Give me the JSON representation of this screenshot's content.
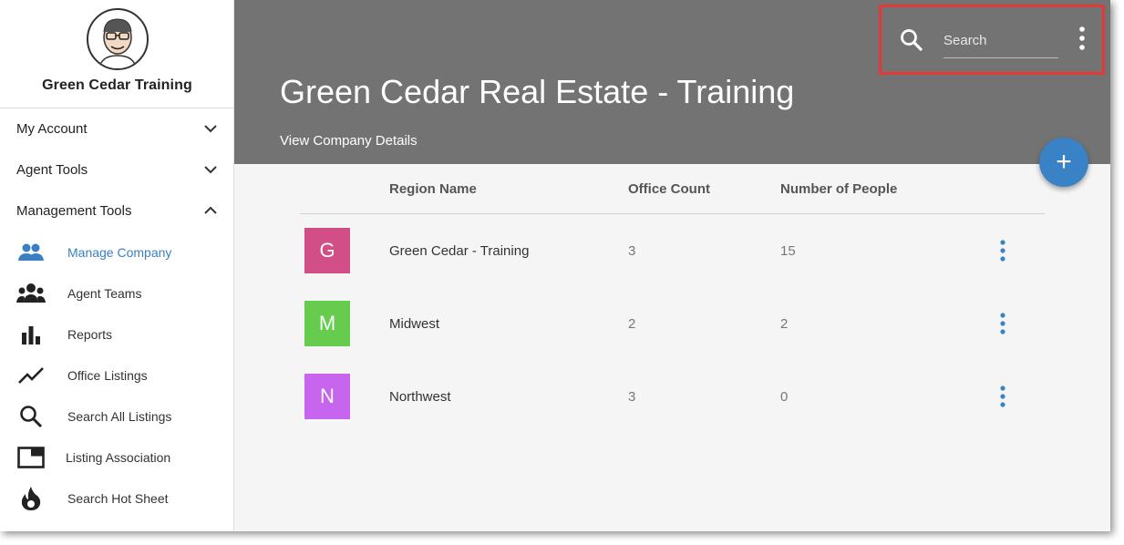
{
  "sidebar": {
    "profile_name": "Green Cedar Training",
    "sections": [
      {
        "label": "My Account",
        "expanded": false
      },
      {
        "label": "Agent Tools",
        "expanded": false
      },
      {
        "label": "Management Tools",
        "expanded": true
      }
    ],
    "items": [
      {
        "label": "Manage Company",
        "icon": "people-icon",
        "active": true
      },
      {
        "label": "Agent Teams",
        "icon": "team-icon",
        "active": false
      },
      {
        "label": "Reports",
        "icon": "bar-chart-icon",
        "active": false
      },
      {
        "label": "Office Listings",
        "icon": "trend-line-icon",
        "active": false
      },
      {
        "label": "Search All Listings",
        "icon": "search-icon",
        "active": false
      },
      {
        "label": "Listing Association",
        "icon": "window-icon",
        "active": false
      },
      {
        "label": "Search Hot Sheet",
        "icon": "flame-icon",
        "active": false
      }
    ]
  },
  "header": {
    "title": "Green Cedar Real Estate - Training",
    "details_link": "View Company Details",
    "search_placeholder": "Search",
    "fab_label": "+"
  },
  "table": {
    "columns": [
      "Region Name",
      "Office Count",
      "Number of People"
    ],
    "rows": [
      {
        "initial": "G",
        "name": "Green Cedar - Training",
        "offices": "3",
        "people": "15",
        "color": "#d14f86"
      },
      {
        "initial": "M",
        "name": "Midwest",
        "offices": "2",
        "people": "2",
        "color": "#66cc4e"
      },
      {
        "initial": "N",
        "name": "Northwest",
        "offices": "3",
        "people": "0",
        "color": "#c865ef"
      }
    ]
  },
  "colors": {
    "accent": "#3a82c6",
    "header_bg": "#737373",
    "highlight": "#e53935"
  }
}
